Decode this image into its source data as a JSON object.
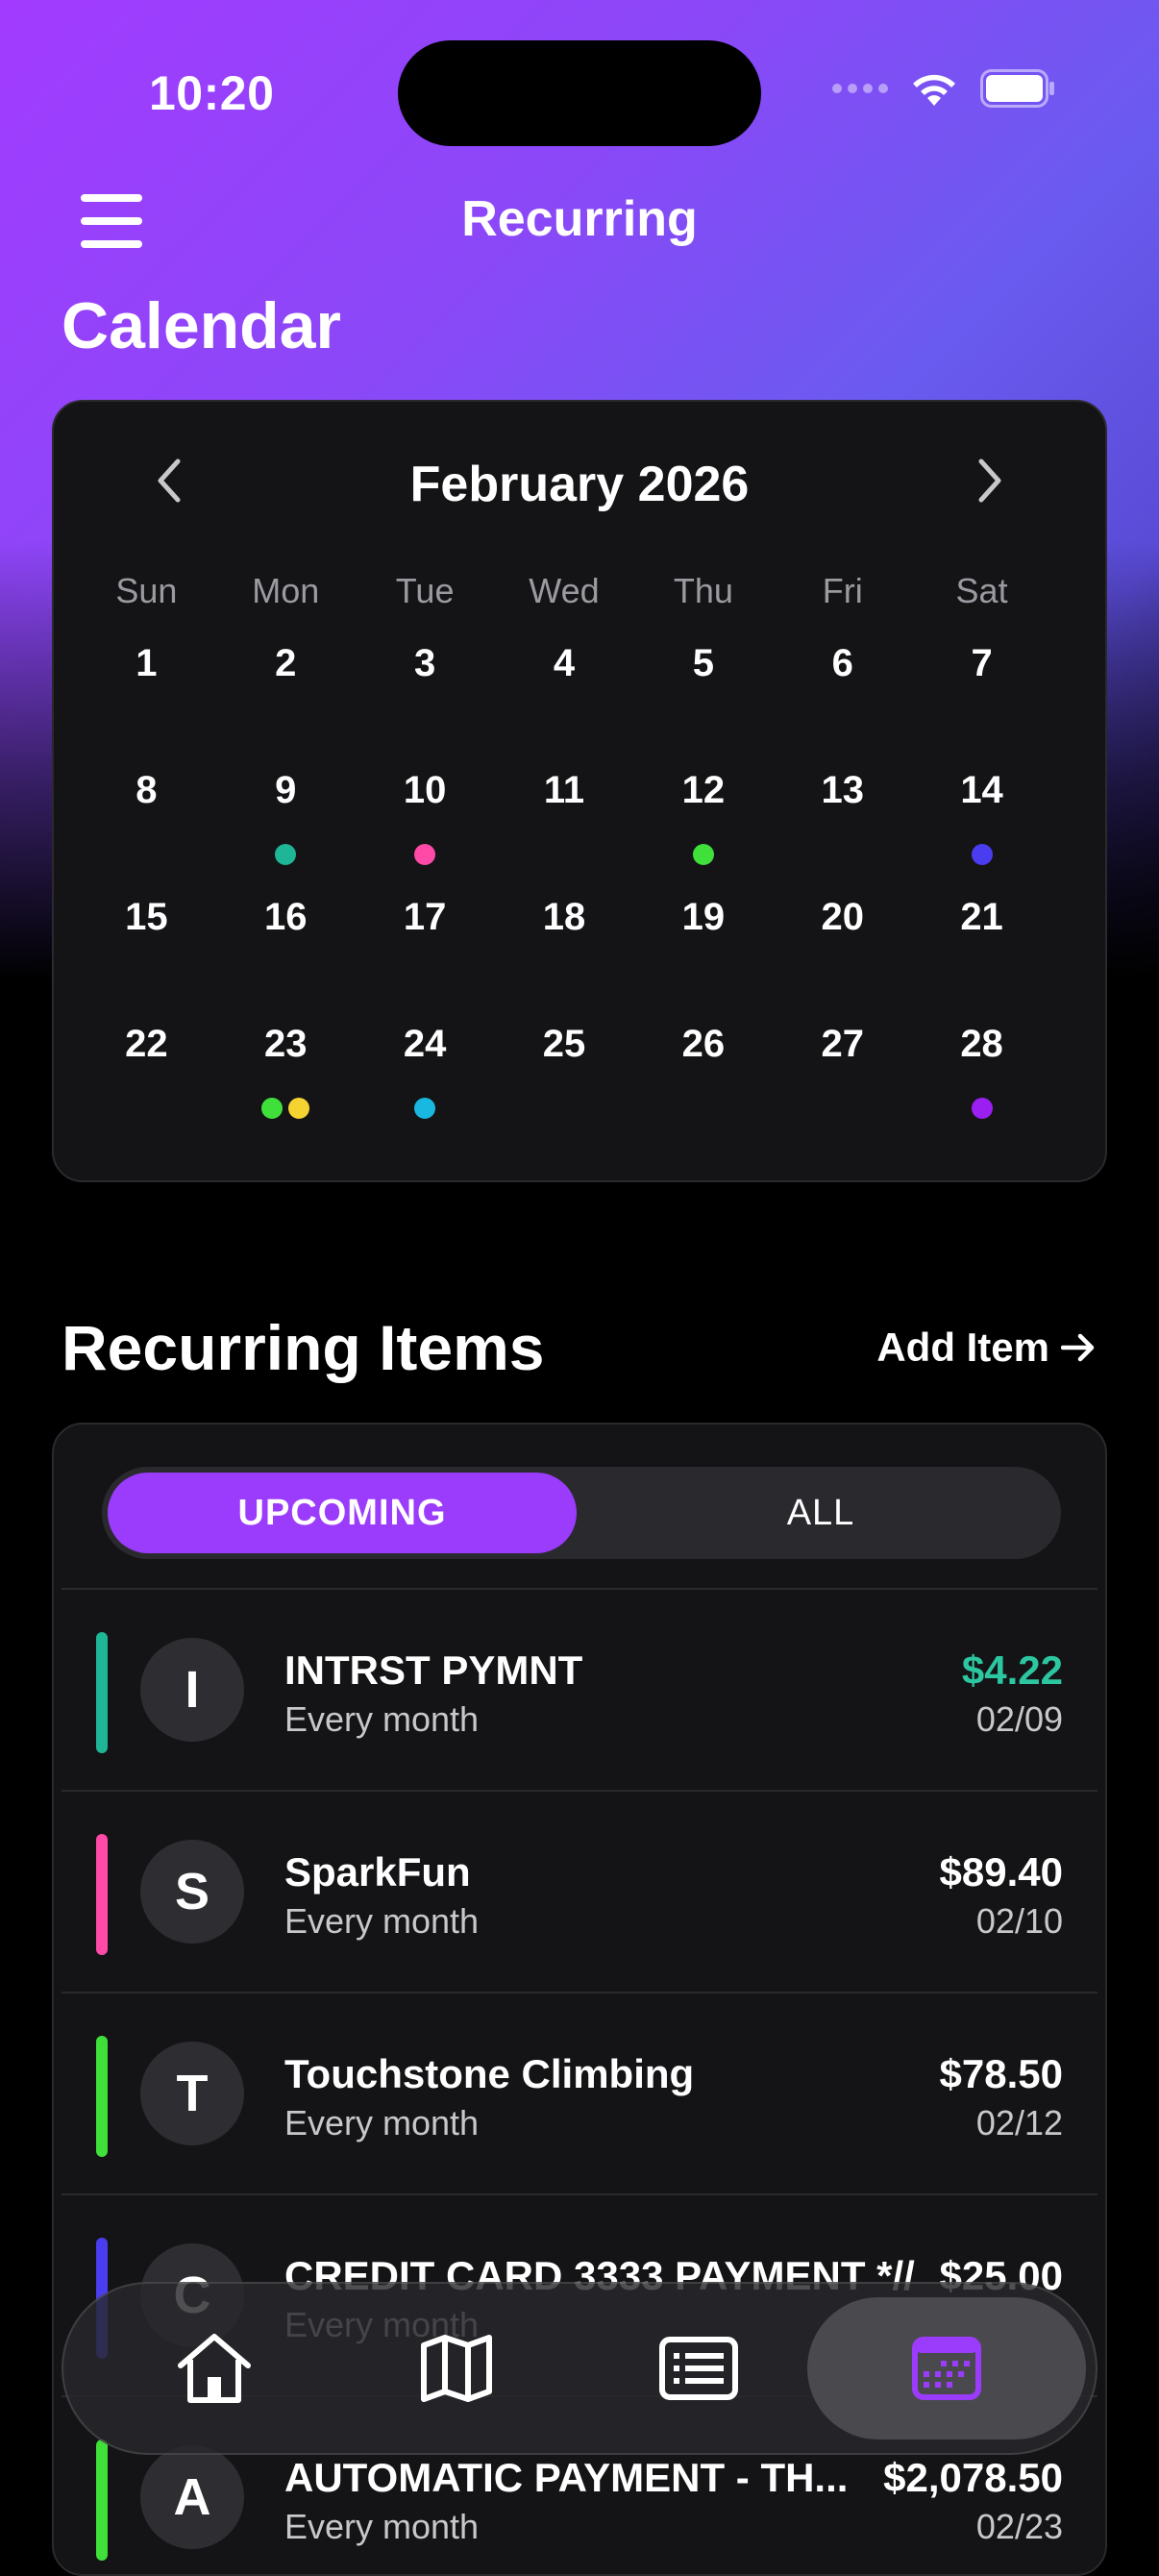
{
  "status": {
    "time": "10:20"
  },
  "nav": {
    "title": "Recurring"
  },
  "calendar": {
    "section_title": "Calendar",
    "month_label": "February 2026",
    "weekdays": [
      "Sun",
      "Mon",
      "Tue",
      "Wed",
      "Thu",
      "Fri",
      "Sat"
    ],
    "weeks": [
      [
        {
          "d": "1"
        },
        {
          "d": "2"
        },
        {
          "d": "3"
        },
        {
          "d": "4"
        },
        {
          "d": "5"
        },
        {
          "d": "6"
        },
        {
          "d": "7"
        }
      ],
      [
        {
          "d": "8"
        },
        {
          "d": "9",
          "dots": [
            "#1fb597"
          ]
        },
        {
          "d": "10",
          "dots": [
            "#ff4aa8"
          ]
        },
        {
          "d": "11"
        },
        {
          "d": "12",
          "dots": [
            "#3fe03a"
          ]
        },
        {
          "d": "13"
        },
        {
          "d": "14",
          "dots": [
            "#4a3df0"
          ]
        }
      ],
      [
        {
          "d": "15"
        },
        {
          "d": "16"
        },
        {
          "d": "17"
        },
        {
          "d": "18"
        },
        {
          "d": "19"
        },
        {
          "d": "20"
        },
        {
          "d": "21"
        }
      ],
      [
        {
          "d": "22"
        },
        {
          "d": "23",
          "dots": [
            "#3fe03a",
            "#f5d431"
          ]
        },
        {
          "d": "24",
          "dots": [
            "#18b8e0"
          ]
        },
        {
          "d": "25"
        },
        {
          "d": "26"
        },
        {
          "d": "27"
        },
        {
          "d": "28",
          "dots": [
            "#9b1ff0"
          ]
        }
      ]
    ]
  },
  "recurring": {
    "section_title": "Recurring Items",
    "add_label": "Add Item",
    "tabs": {
      "upcoming": "UPCOMING",
      "all": "ALL"
    },
    "items": [
      {
        "initial": "I",
        "name": "INTRST PYMNT",
        "frequency": "Every month",
        "amount": "$4.22",
        "date": "02/09",
        "color": "#1fb597",
        "amount_color": "#2cc6a0"
      },
      {
        "initial": "S",
        "name": "SparkFun",
        "frequency": "Every month",
        "amount": "$89.40",
        "date": "02/10",
        "color": "#ff4aa8",
        "amount_color": "#ffffff"
      },
      {
        "initial": "T",
        "name": "Touchstone Climbing",
        "frequency": "Every month",
        "amount": "$78.50",
        "date": "02/12",
        "color": "#3fe03a",
        "amount_color": "#ffffff"
      },
      {
        "initial": "C",
        "name": "CREDIT CARD 3333 PAYMENT *//",
        "frequency": "Every month",
        "amount": "$25.00",
        "date": "02/14",
        "color": "#4a3df0",
        "amount_color": "#ffffff"
      },
      {
        "initial": "A",
        "name": "AUTOMATIC PAYMENT - TH...",
        "frequency": "Every month",
        "amount": "$2,078.50",
        "date": "02/23",
        "color": "#3fe03a",
        "amount_color": "#ffffff"
      }
    ]
  },
  "tabbar": {
    "tabs": [
      {
        "name": "home-tab",
        "icon": "home-icon"
      },
      {
        "name": "map-tab",
        "icon": "map-icon"
      },
      {
        "name": "transactions-tab",
        "icon": "list-icon"
      },
      {
        "name": "calendar-tab",
        "icon": "calendar-icon",
        "active": true
      }
    ],
    "accent": "#9b3bfb"
  }
}
